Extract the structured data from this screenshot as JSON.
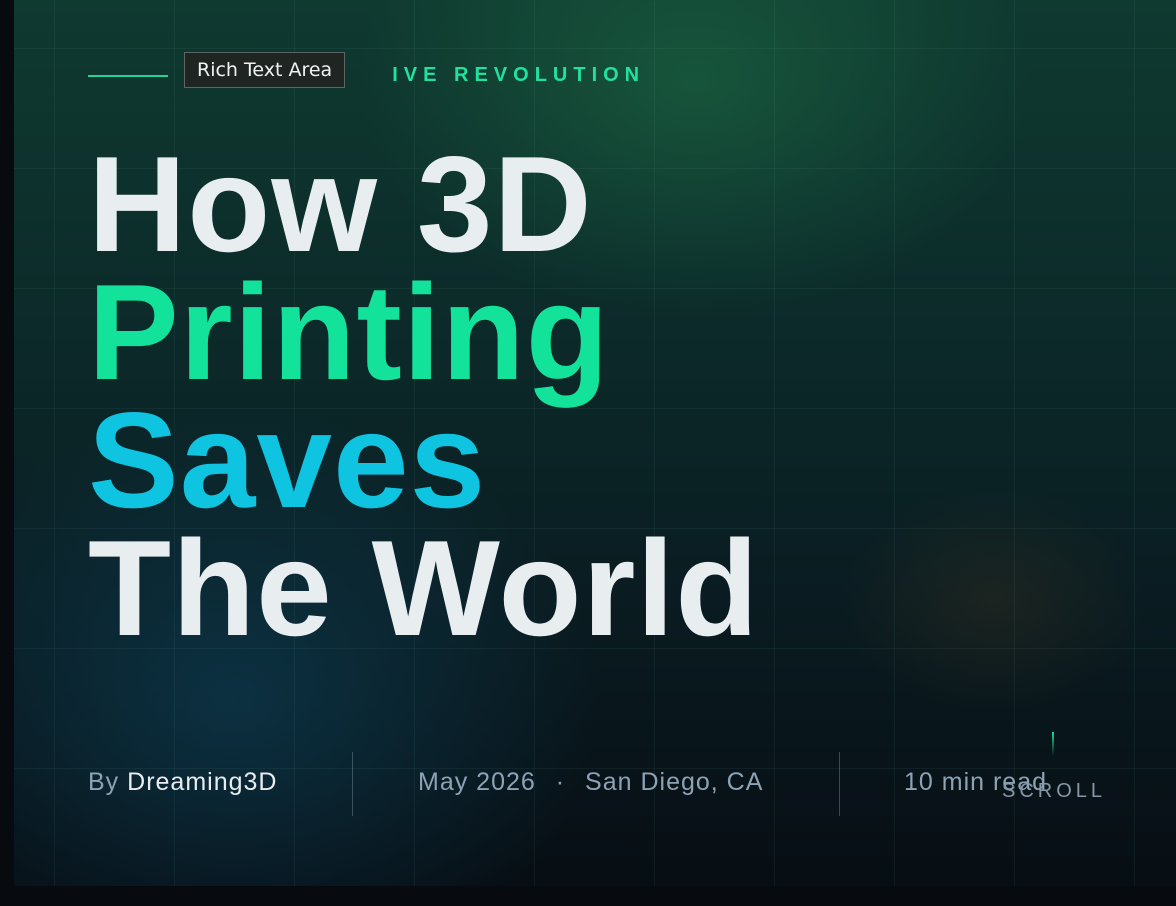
{
  "tooltip": {
    "text": "Rich Text Area"
  },
  "hero": {
    "eyebrow_visible": "T",
    "eyebrow_text": "IVE REVOLUTION",
    "headline": {
      "line1": "How 3D",
      "line2": "Printing",
      "line3": "Saves",
      "line4": "The World"
    },
    "meta": {
      "by_label": "By",
      "author": "Dreaming3D",
      "date": "May 2026",
      "separator": "·",
      "location": "San Diego, CA",
      "read_time": "10 min read"
    },
    "scroll_label": "SCROLL"
  },
  "colors": {
    "accent_green": "#13e39a",
    "accent_cyan": "#0fc4e0",
    "headline_white": "#e8edf0",
    "meta_muted": "#8da2b4"
  }
}
